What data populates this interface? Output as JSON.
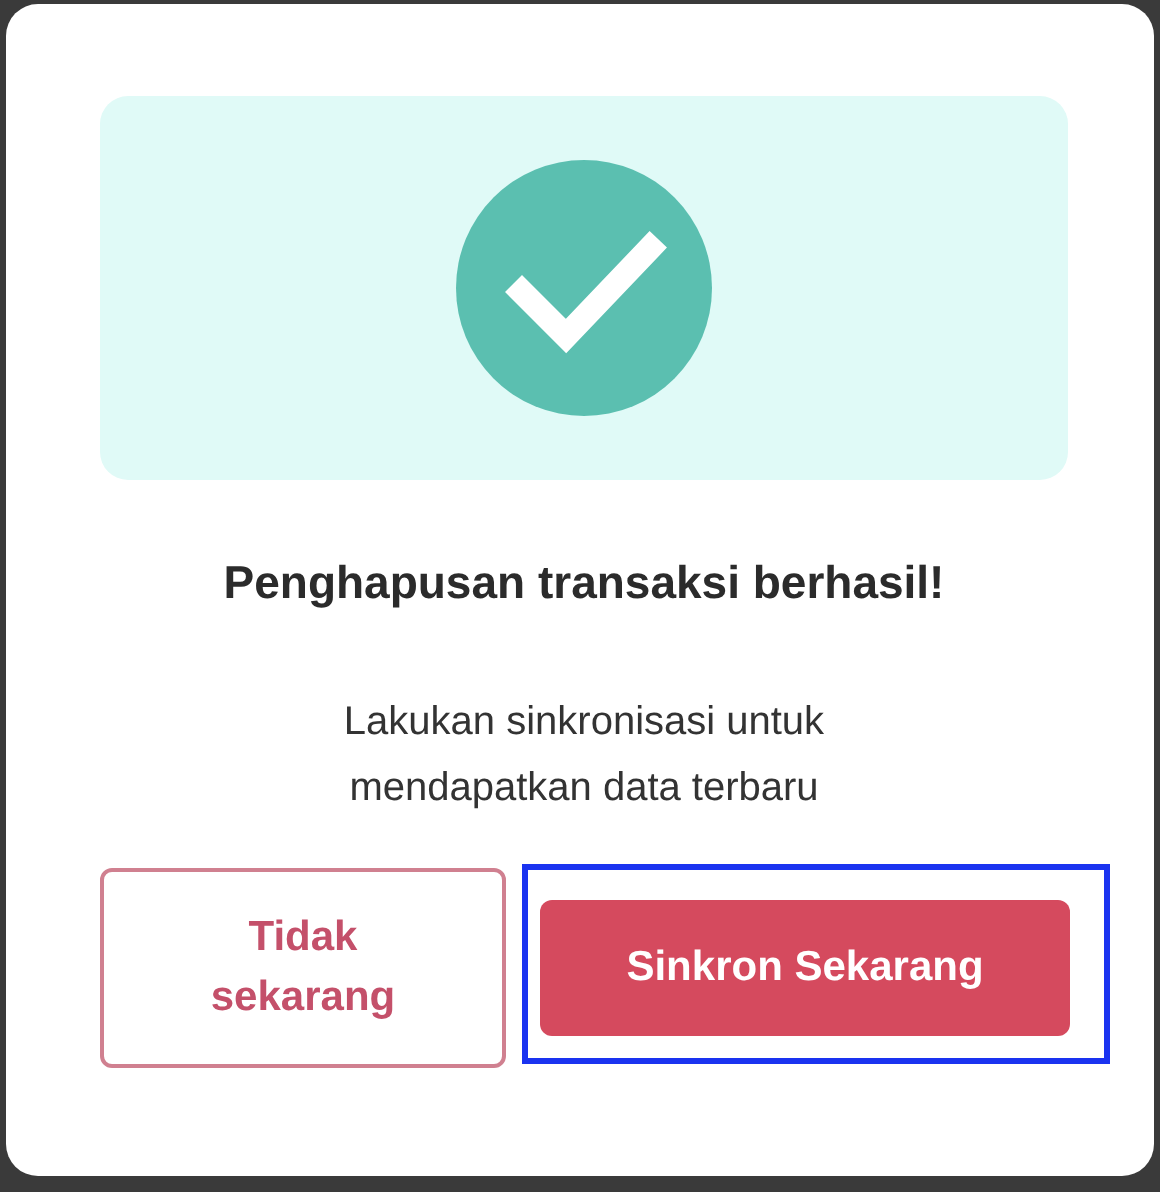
{
  "dialog": {
    "title": "Penghapusan transaksi berhasil!",
    "message": "Lakukan sinkronisasi untuk mendapatkan data terbaru",
    "buttons": [
      {
        "label": "Tidak sekarang",
        "kind": "outline",
        "highlighted": false
      },
      {
        "label": "Sinkron Sekarang",
        "kind": "filled",
        "highlighted": true
      }
    ]
  }
}
